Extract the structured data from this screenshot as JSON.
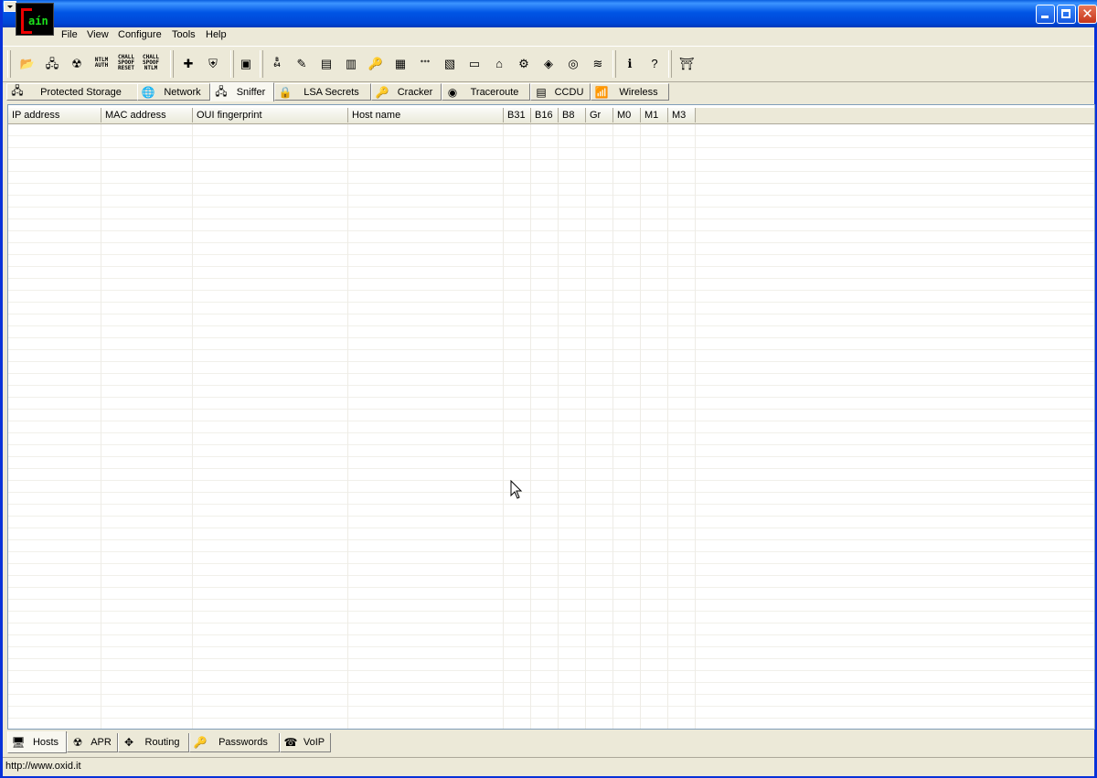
{
  "window": {
    "title": "",
    "logo_text": "aín"
  },
  "menu": [
    "File",
    "View",
    "Configure",
    "Tools",
    "Help"
  ],
  "toolbar": {
    "buttons": [
      {
        "name": "open-folder-icon",
        "glyph": "📂"
      },
      {
        "name": "start-sniffer-icon",
        "glyph": "🖧"
      },
      {
        "name": "start-apr-icon",
        "glyph": "☢"
      },
      {
        "name": "ntlm-auth-icon",
        "text": "NTLM AUTH"
      },
      {
        "name": "chall-spoof-reset-icon",
        "text": "CHALL SPOOF RESET"
      },
      {
        "name": "chall-spoof-ntlm-icon",
        "text": "CHALL SPOOF NTLM"
      },
      {
        "name": "add-icon",
        "glyph": "✚"
      },
      {
        "name": "remove-icon",
        "glyph": "⛨"
      },
      {
        "name": "certificate-icon",
        "glyph": "▣"
      },
      {
        "name": "base64-icon",
        "text": "B 64"
      },
      {
        "name": "hash-calculator-icon",
        "glyph": "✎"
      },
      {
        "name": "lsa-icon",
        "glyph": "▤"
      },
      {
        "name": "mpd-icon",
        "glyph": "▥"
      },
      {
        "name": "key-icon",
        "glyph": "🔑"
      },
      {
        "name": "rdp-icon",
        "glyph": "▦"
      },
      {
        "name": "password-reveal-icon",
        "text": "***"
      },
      {
        "name": "box-revealer-icon",
        "glyph": "▧"
      },
      {
        "name": "cisco-icon",
        "glyph": "▭"
      },
      {
        "name": "access-db-icon",
        "glyph": "⌂"
      },
      {
        "name": "network-enum-icon",
        "glyph": "⚙"
      },
      {
        "name": "wireless-key-icon",
        "glyph": "◈"
      },
      {
        "name": "keyfinder-icon",
        "glyph": "◎"
      },
      {
        "name": "route-icon",
        "glyph": "≋"
      },
      {
        "name": "about-icon",
        "glyph": "ℹ"
      },
      {
        "name": "help-icon",
        "glyph": "?"
      },
      {
        "name": "exit-icon",
        "glyph": "⛩"
      }
    ]
  },
  "top_tabs": [
    {
      "label": "Protected Storage",
      "icon": "protected-storage-icon",
      "glyph": "🖧",
      "active": false
    },
    {
      "label": "Network",
      "icon": "network-icon",
      "glyph": "🌐",
      "active": false
    },
    {
      "label": "Sniffer",
      "icon": "sniffer-icon",
      "glyph": "🖧",
      "active": true
    },
    {
      "label": "LSA Secrets",
      "icon": "lsa-secrets-icon",
      "glyph": "🔒",
      "active": false
    },
    {
      "label": "Cracker",
      "icon": "cracker-icon",
      "glyph": "🔑",
      "active": false
    },
    {
      "label": "Traceroute",
      "icon": "traceroute-icon",
      "glyph": "◉",
      "active": false
    },
    {
      "label": "CCDU",
      "icon": "ccdu-icon",
      "glyph": "▤",
      "active": false
    },
    {
      "label": "Wireless",
      "icon": "wireless-icon",
      "glyph": "📶",
      "active": false
    }
  ],
  "table": {
    "columns": [
      "IP address",
      "MAC address",
      "OUI fingerprint",
      "Host name",
      "B31",
      "B16",
      "B8",
      "Gr",
      "M0",
      "M1",
      "M3"
    ],
    "rows": []
  },
  "bottom_tabs": [
    {
      "label": "Hosts",
      "icon": "hosts-icon",
      "glyph": "🖥",
      "active": true
    },
    {
      "label": "APR",
      "icon": "apr-icon",
      "glyph": "☢",
      "active": false
    },
    {
      "label": "Routing",
      "icon": "routing-icon",
      "glyph": "✥",
      "active": false
    },
    {
      "label": "Passwords",
      "icon": "passwords-icon",
      "glyph": "🔑",
      "active": false
    },
    {
      "label": "VoIP",
      "icon": "voip-icon",
      "glyph": "☎",
      "active": false
    }
  ],
  "status": {
    "text": "http://www.oxid.it"
  }
}
